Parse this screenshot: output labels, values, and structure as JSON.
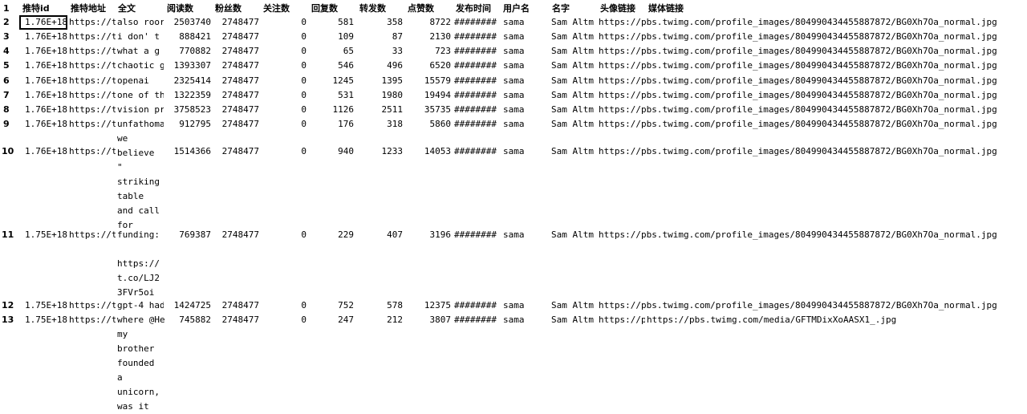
{
  "headers": {
    "col_a": "推特id",
    "col_b": "推特地址",
    "col_c": "全文",
    "col_d": "阅读数",
    "col_e": "粉丝数",
    "col_f": "关注数",
    "col_g": "回复数",
    "col_h": "转发数",
    "col_i": "点赞数",
    "col_j": "发布时间",
    "col_k": "用户名",
    "col_l": "名字",
    "col_m": "头像链接",
    "col_n": "媒体链接"
  },
  "rows": [
    {
      "rownum": "1"
    },
    {
      "rownum": "2",
      "id": "1.76E+18",
      "url": "https://t",
      "text": "also roor",
      "reads": "2503740",
      "followers": "2748477",
      "following": "0",
      "replies": "581",
      "retweets": "358",
      "likes": "8722",
      "time": "########",
      "user": "sama",
      "name": "Sam Altm",
      "avatar": "https://pbs.twimg.com/profile_images/804990434455887872/BG0Xh7Oa_normal.jpg"
    },
    {
      "rownum": "3",
      "id": "1.76E+18",
      "url": "https://t",
      "text": "i don' t",
      "reads": "888421",
      "followers": "2748477",
      "following": "0",
      "replies": "109",
      "retweets": "87",
      "likes": "2130",
      "time": "########",
      "user": "sama",
      "name": "Sam Altm",
      "avatar": "https://pbs.twimg.com/profile_images/804990434455887872/BG0Xh7Oa_normal.jpg"
    },
    {
      "rownum": "4",
      "id": "1.76E+18",
      "url": "https://t",
      "text": "what a g",
      "reads": "770882",
      "followers": "2748477",
      "following": "0",
      "replies": "65",
      "retweets": "33",
      "likes": "723",
      "time": "########",
      "user": "sama",
      "name": "Sam Altm",
      "avatar": "https://pbs.twimg.com/profile_images/804990434455887872/BG0Xh7Oa_normal.jpg"
    },
    {
      "rownum": "5",
      "id": "1.76E+18",
      "url": "https://t",
      "text": "chaotic g",
      "reads": "1393307",
      "followers": "2748477",
      "following": "0",
      "replies": "546",
      "retweets": "496",
      "likes": "6520",
      "time": "########",
      "user": "sama",
      "name": "Sam Altm",
      "avatar": "https://pbs.twimg.com/profile_images/804990434455887872/BG0Xh7Oa_normal.jpg"
    },
    {
      "rownum": "6",
      "id": "1.76E+18",
      "url": "https://t",
      "text": "openai",
      "reads": "2325414",
      "followers": "2748477",
      "following": "0",
      "replies": "1245",
      "retweets": "1395",
      "likes": "15579",
      "time": "########",
      "user": "sama",
      "name": "Sam Altm",
      "avatar": "https://pbs.twimg.com/profile_images/804990434455887872/BG0Xh7Oa_normal.jpg"
    },
    {
      "rownum": "7",
      "id": "1.76E+18",
      "url": "https://t",
      "text": "one of th",
      "reads": "1322359",
      "followers": "2748477",
      "following": "0",
      "replies": "531",
      "retweets": "1980",
      "likes": "19494",
      "time": "########",
      "user": "sama",
      "name": "Sam Altm",
      "avatar": "https://pbs.twimg.com/profile_images/804990434455887872/BG0Xh7Oa_normal.jpg"
    },
    {
      "rownum": "8",
      "id": "1.76E+18",
      "url": "https://t",
      "text": "vision pr",
      "reads": "3758523",
      "followers": "2748477",
      "following": "0",
      "replies": "1126",
      "retweets": "2511",
      "likes": "35735",
      "time": "########",
      "user": "sama",
      "name": "Sam Altm",
      "avatar": "https://pbs.twimg.com/profile_images/804990434455887872/BG0Xh7Oa_normal.jpg"
    },
    {
      "rownum": "9",
      "id": "1.76E+18",
      "url": "https://t",
      "text": "unfathoma",
      "reads": "912795",
      "followers": "2748477",
      "following": "0",
      "replies": "176",
      "retweets": "318",
      "likes": "5860",
      "time": "########",
      "user": "sama",
      "name": "Sam Altm",
      "avatar": "https://pbs.twimg.com/profile_images/804990434455887872/BG0Xh7Oa_normal.jpg"
    },
    {
      "rownum": "10",
      "id": "1.76E+18",
      "url": "https://t",
      "text": "we\nbelieve\n\"\nstriking\ntable\nand call\nfor",
      "reads": "1514366",
      "followers": "2748477",
      "following": "0",
      "replies": "940",
      "retweets": "1233",
      "likes": "14053",
      "time": "########",
      "user": "sama",
      "name": "Sam Altm",
      "avatar": "https://pbs.twimg.com/profile_images/804990434455887872/BG0Xh7Oa_normal.jpg"
    },
    {
      "rownum": "11",
      "id": "1.75E+18",
      "url": "https://t",
      "text": "funding:\n\nhttps://\nt.co/LJ2\n3FVr5oi",
      "reads": "769387",
      "followers": "2748477",
      "following": "0",
      "replies": "229",
      "retweets": "407",
      "likes": "3196",
      "time": "########",
      "user": "sama",
      "name": "Sam Altm",
      "avatar": "https://pbs.twimg.com/profile_images/804990434455887872/BG0Xh7Oa_normal.jpg"
    },
    {
      "rownum": "12",
      "id": "1.75E+18",
      "url": "https://t",
      "text": "gpt-4 had",
      "reads": "1424725",
      "followers": "2748477",
      "following": "0",
      "replies": "752",
      "retweets": "578",
      "likes": "12375",
      "time": "########",
      "user": "sama",
      "name": "Sam Altm",
      "avatar": "https://pbs.twimg.com/profile_images/804990434455887872/BG0Xh7Oa_normal.jpg"
    },
    {
      "rownum": "13",
      "id": "1.75E+18",
      "url": "https://t",
      "text": "where @He\nmy\nbrother\nfounded\na\nunicorn,\nwas it",
      "reads": "745882",
      "followers": "2748477",
      "following": "0",
      "replies": "247",
      "retweets": "212",
      "likes": "3807",
      "time": "########",
      "user": "sama",
      "name": "Sam Altm",
      "avatar": "https://p",
      "media": "https://pbs.twimg.com/media/GFTMDixXoAASX1_.jpg"
    }
  ]
}
